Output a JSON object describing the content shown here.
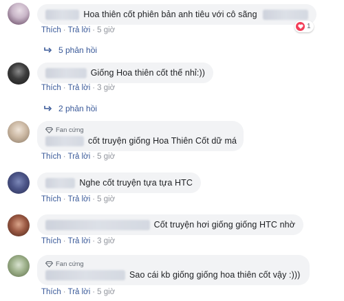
{
  "comments": [
    {
      "text": "Hoa thiên cốt phiên bản anh tiêu với cô sãng",
      "reaction_count": "1",
      "actions": {
        "like": "Thích",
        "reply": "Trả lời",
        "time": "5 giờ"
      },
      "replies_label": "5 phản hồi"
    },
    {
      "text": "Giống Hoa thiên cốt thế nhỉ:))",
      "actions": {
        "like": "Thích",
        "reply": "Trả lời",
        "time": "3 giờ"
      },
      "replies_label": "2 phản hồi"
    },
    {
      "badge": "Fan cứng",
      "text": "cốt truyện giống Hoa Thiên Cốt dữ má",
      "actions": {
        "like": "Thích",
        "reply": "Trả lời",
        "time": "5 giờ"
      }
    },
    {
      "text": "Nghe cốt truyện tựa tựa HTC",
      "actions": {
        "like": "Thích",
        "reply": "Trả lời",
        "time": "5 giờ"
      }
    },
    {
      "text": "Cốt truyện hơi giống giống HTC nhờ",
      "actions": {
        "like": "Thích",
        "reply": "Trả lời",
        "time": "3 giờ"
      }
    },
    {
      "badge": "Fan cứng",
      "text": "Sao cái kb giống giống hoa thiên cốt vậy :)))",
      "actions": {
        "like": "Thích",
        "reply": "Trả lời",
        "time": "5 giờ"
      }
    }
  ],
  "icons": {
    "reaction": "heart-icon",
    "replies": "reply-arrow-icon",
    "badge": "diamond-icon"
  },
  "colors": {
    "link": "#385898",
    "bubble": "#f2f3f5",
    "meta": "#90949c",
    "heart": "#f33e58"
  }
}
